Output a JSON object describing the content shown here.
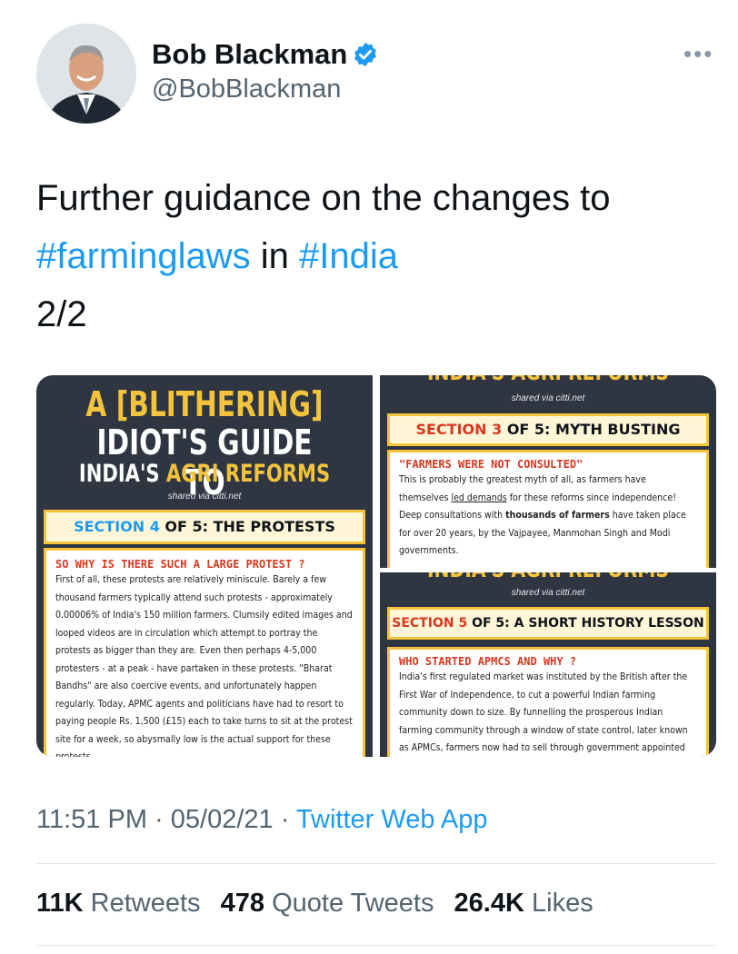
{
  "author": {
    "name": "Bob Blackman",
    "handle": "@BobBlackman"
  },
  "tweet": {
    "line1": "Further guidance on the changes to",
    "tag1": "#farminglaws",
    "mid": " in ",
    "tag2": "#India",
    "line3": "2/2"
  },
  "media": {
    "panel1": {
      "title_line1": "A [BLITHERING]",
      "title_line2": "IDIOT'S GUIDE TO",
      "title_line3_a": "INDIA'S ",
      "title_line3_b": "AGRI REFORMS",
      "shared": "shared via citti.net",
      "section_a": "SECTION 4 ",
      "section_b": "OF 5: THE PROTESTS",
      "question": "SO WHY IS THERE SUCH A LARGE PROTEST ?",
      "body": "First of all, these protests are relatively miniscule. Barely a few thousand farmers typically attend such protests - approximately 0.00006% of India's 150 million farmers. Clumsily edited images and looped videos are in circulation which attempt to portray the protests as bigger than they are. Even then perhaps 4-5,000 protesters - at a peak - have partaken in these protests. \"Bharat Bandhs\" are also coercive events, and unfortunately happen regularly. Today, APMC agents and politicians have had to resort to paying people Rs. 1,500 (£15) each to take turns to sit at the protest site for a week, so abysmally low is the actual support for these protests."
    },
    "panel2": {
      "banner": "INDIA'S AGRI REFORMS",
      "shared": "shared via citti.net",
      "section_a": "SECTION 3 ",
      "section_b": "OF 5: MYTH BUSTING",
      "question": "\"FARMERS WERE NOT CONSULTED\"",
      "body_a": "This is probably the greatest myth of all, as farmers have themselves ",
      "body_link": "led demands",
      "body_b": " for these reforms since independence! Deep consultations with ",
      "body_bold": "thousands of farmers",
      "body_c": " have taken place for over 20 years, by the Vajpayee, Manmohan Singh and Modi governments."
    },
    "panel3": {
      "banner": "INDIA'S AGRI REFORMS",
      "shared": "shared via citti.net",
      "section_a": "SECTION 5 ",
      "section_b": "OF 5: A SHORT HISTORY LESSON",
      "question": "WHO STARTED APMCS AND WHY ?",
      "body": "India's first regulated market was instituted by the British after the First War of Independence, to cut a powerful Indian farming community down to size. By funnelling the prosperous Indian farming community through a window of state control, later known as APMCs, farmers now had to sell through government appointed agents and at lower prices. This ensured that they"
    }
  },
  "meta": {
    "time": "11:51 PM",
    "sep1": " · ",
    "date": "05/02/21",
    "sep2": " · ",
    "app": "Twitter Web App"
  },
  "stats": {
    "retweets_count": "11K",
    "retweets_label": " Retweets",
    "quotes_count": "478",
    "quotes_label": " Quote Tweets",
    "likes_count": "26.4K",
    "likes_label": " Likes"
  },
  "colors": {
    "link": "#1d9bf0",
    "accent_yellow": "#f3c33c",
    "panel_bg": "#2f3642",
    "red": "#d8381f"
  },
  "icons": [
    "verified-badge-icon",
    "more-options-icon"
  ]
}
